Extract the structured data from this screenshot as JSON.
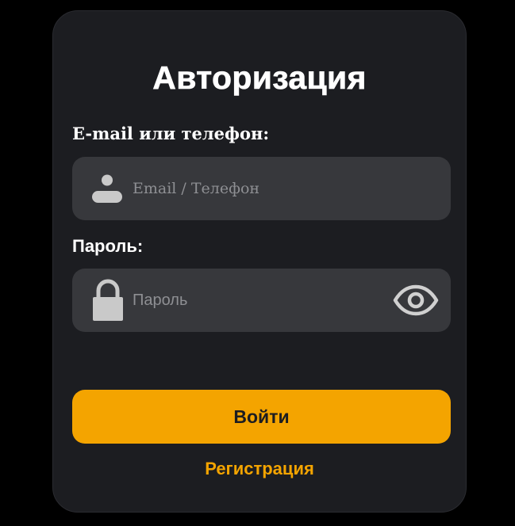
{
  "form": {
    "title": "Авторизация",
    "email_label": "E-mail или телефон:",
    "email_placeholder": "Email / Телефон",
    "email_value": "",
    "email_icon": "user-icon",
    "password_label": "Пароль:",
    "password_placeholder": "Пароль",
    "password_value": "",
    "password_icon": "lock-icon",
    "password_toggle_icon": "eye-icon",
    "submit_label": "Войти",
    "register_label": "Регистрация"
  },
  "colors": {
    "background": "#000000",
    "card": "#1c1d21",
    "field": "#37383c",
    "accent": "#f4a400",
    "icon": "#c9c9c9",
    "text": "#ffffff"
  }
}
